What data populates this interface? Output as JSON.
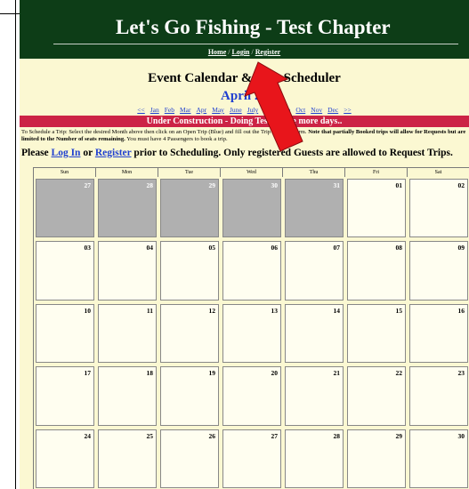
{
  "site_title": "Let's Go Fishing - Test Chapter",
  "nav": {
    "home": "Home",
    "sep1": "/",
    "login": "Login",
    "sep2": "/",
    "register": "Register"
  },
  "calendar_title": "Event Calendar & Trip Scheduler",
  "month_label": "April 20",
  "month_nav": {
    "prev": "<<",
    "months": [
      "Jan",
      "Feb",
      "Mar",
      "Apr",
      "May",
      "June",
      "July",
      "Aug",
      "Sep",
      "Oct",
      "Nov",
      "Dec"
    ],
    "next": ">>"
  },
  "banner": "Under Construction - Doing Testing - le more days..",
  "instructions": {
    "line1": "To Schedule a Trip: Select the desired Month above then click on an Open Trip (Blue) and fill out the Trip Request Form.",
    "note": "Note that partially Booked trips will allow for Requests but are limited to the Number of seats remaining.",
    "line2": "You must have 4 Passengers to book a trip."
  },
  "login_message": {
    "prefix": "Please",
    "login": "Log In",
    "or": "or",
    "register": "Register",
    "suffix": "prior to Scheduling. Only registered Guests are allowed to Request Trips."
  },
  "day_headers": [
    "Sun",
    "Mon",
    "Tue",
    "Wed",
    "Thu",
    "Fri",
    "Sat"
  ],
  "weeks": [
    [
      "27",
      "28",
      "29",
      "30",
      "31",
      "01",
      "02"
    ],
    [
      "03",
      "04",
      "05",
      "06",
      "07",
      "08",
      "09"
    ],
    [
      "10",
      "11",
      "12",
      "13",
      "14",
      "15",
      "16"
    ],
    [
      "17",
      "18",
      "19",
      "20",
      "21",
      "22",
      "23"
    ],
    [
      "24",
      "25",
      "26",
      "27",
      "28",
      "29",
      "30"
    ]
  ],
  "greyed_days_first_week": 5,
  "colors": {
    "header": "#0d3d17",
    "background": "#fbf8d2",
    "banner": "#cc2346",
    "link": "#1f3fd0",
    "arrow": "#e8151b"
  }
}
